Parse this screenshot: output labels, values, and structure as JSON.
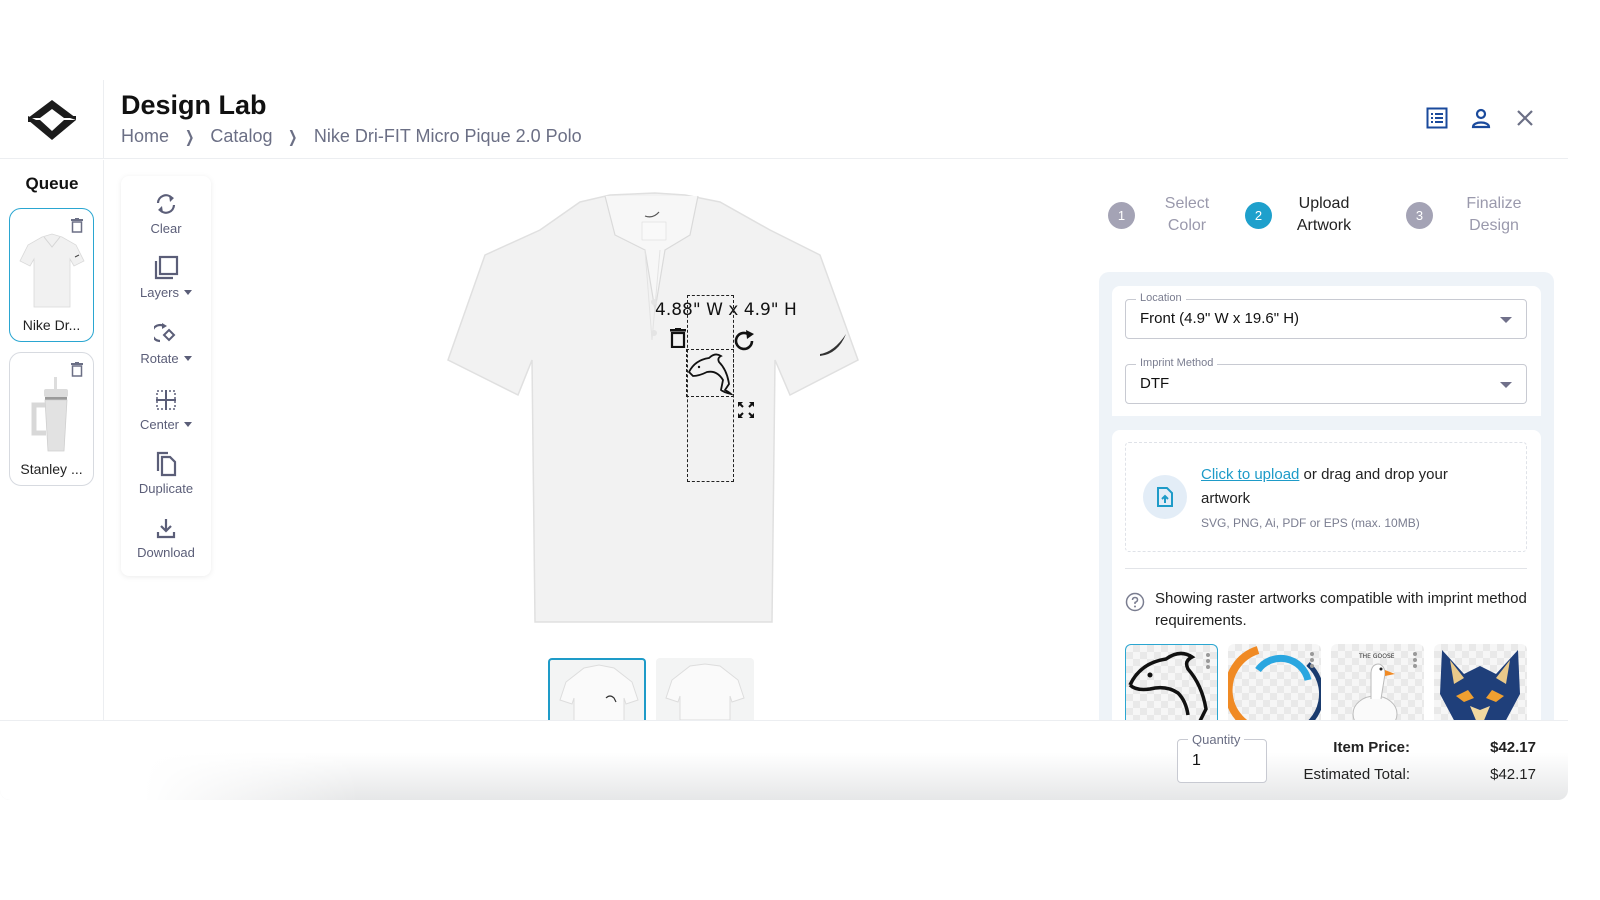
{
  "header": {
    "title": "Design Lab",
    "breadcrumb": [
      "Home",
      "Catalog",
      "Nike Dri-FIT Micro Pique 2.0 Polo"
    ],
    "icons": [
      "list-icon",
      "user-icon",
      "close-icon"
    ]
  },
  "queue": {
    "title": "Queue",
    "items": [
      {
        "label": "Nike Dr...",
        "active": true
      },
      {
        "label": "Stanley ...",
        "active": false
      }
    ]
  },
  "toolbar": {
    "clear": "Clear",
    "layers": "Layers",
    "rotate": "Rotate",
    "center": "Center",
    "duplicate": "Duplicate",
    "download": "Download"
  },
  "canvas": {
    "dimensions": "4.88\" W x 4.9\" H",
    "views": [
      "front",
      "back"
    ]
  },
  "steps": [
    {
      "num": "1",
      "line1": "Select",
      "line2": "Color",
      "active": false
    },
    {
      "num": "2",
      "line1": "Upload",
      "line2": "Artwork",
      "active": true
    },
    {
      "num": "3",
      "line1": "Finalize",
      "line2": "Design",
      "active": false
    }
  ],
  "form": {
    "location_label": "Location",
    "location_value": "Front (4.9\" W x 19.6\" H)",
    "imprint_label": "Imprint Method",
    "imprint_value": "DTF"
  },
  "upload": {
    "link": "Click to upload",
    "text": " or drag and drop your artwork",
    "formats": "SVG, PNG, Ai, PDF or EPS (max. 10MB)"
  },
  "note": "Showing raster artworks compatible with imprint method requirements.",
  "artworks": [
    {
      "name": "dolphin",
      "active": true
    },
    {
      "name": "circle-swoosh",
      "active": false
    },
    {
      "name": "goose",
      "active": false,
      "caption": "THE GOOSE"
    },
    {
      "name": "wolf",
      "active": false
    }
  ],
  "footer": {
    "quantity_label": "Quantity",
    "quantity_value": "1",
    "item_price_label": "Item Price:",
    "item_price": "$42.17",
    "total_label": "Estimated Total:",
    "total": "$42.17"
  },
  "colors": {
    "accent": "#1ea0cc",
    "step_inactive": "#a4a3b5",
    "panel_bg": "#eef3f8",
    "icon_blue": "#1a4a9c"
  }
}
